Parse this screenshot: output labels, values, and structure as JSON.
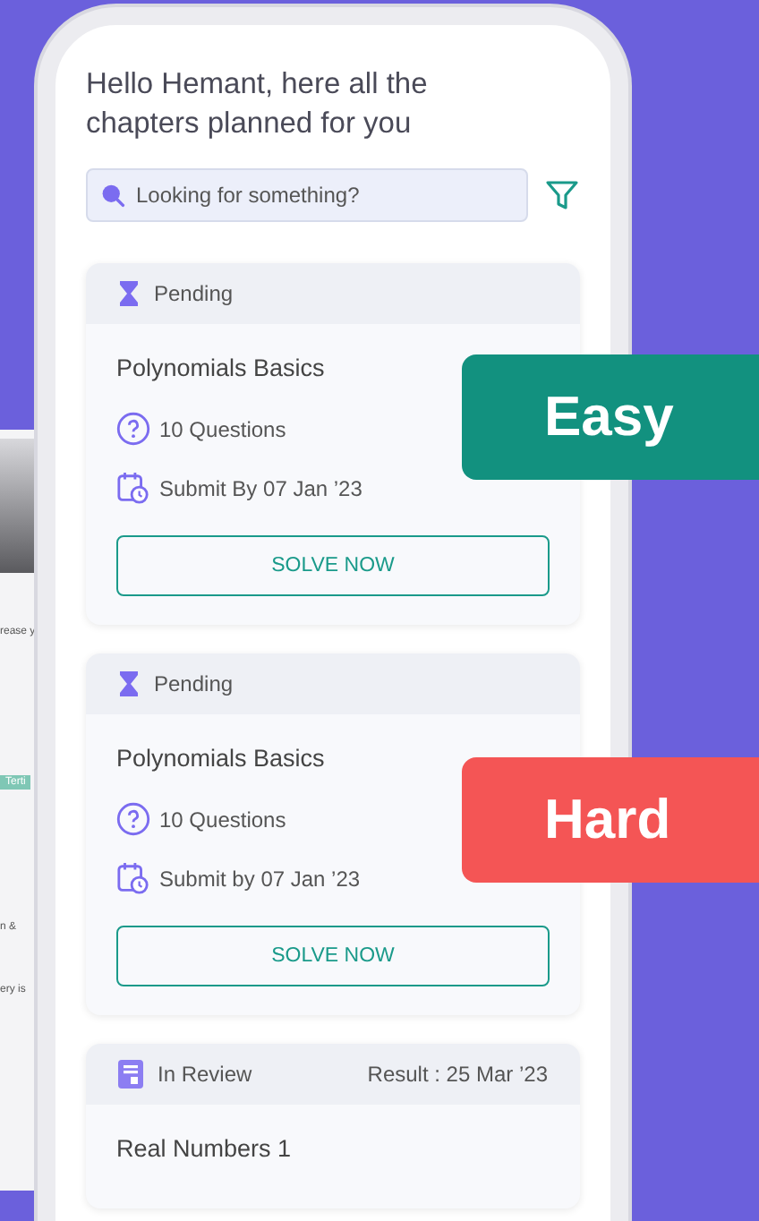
{
  "background_screen": {
    "texts": [
      "rease y",
      "Terti",
      "n &",
      "ery is"
    ]
  },
  "greeting": "Hello Hemant, here all the chapters planned for you",
  "search": {
    "placeholder": "Looking for something?"
  },
  "cards": [
    {
      "status": "Pending",
      "kind": "pending",
      "title": "Polynomials Basics",
      "questions": "10 Questions",
      "due": "Submit By 07 Jan ’23",
      "button": "SOLVE NOW"
    },
    {
      "status": "Pending",
      "kind": "pending",
      "title": "Polynomials Basics",
      "questions": "10 Questions",
      "due": "Submit by 07 Jan ’23",
      "button": "SOLVE NOW"
    },
    {
      "status": "In Review",
      "kind": "review",
      "result": "Result : 25 Mar ’23",
      "title": "Real Numbers 1"
    }
  ],
  "badges": [
    {
      "label": "Easy",
      "color": "#12917f"
    },
    {
      "label": "Hard",
      "color": "#f45555"
    }
  ]
}
